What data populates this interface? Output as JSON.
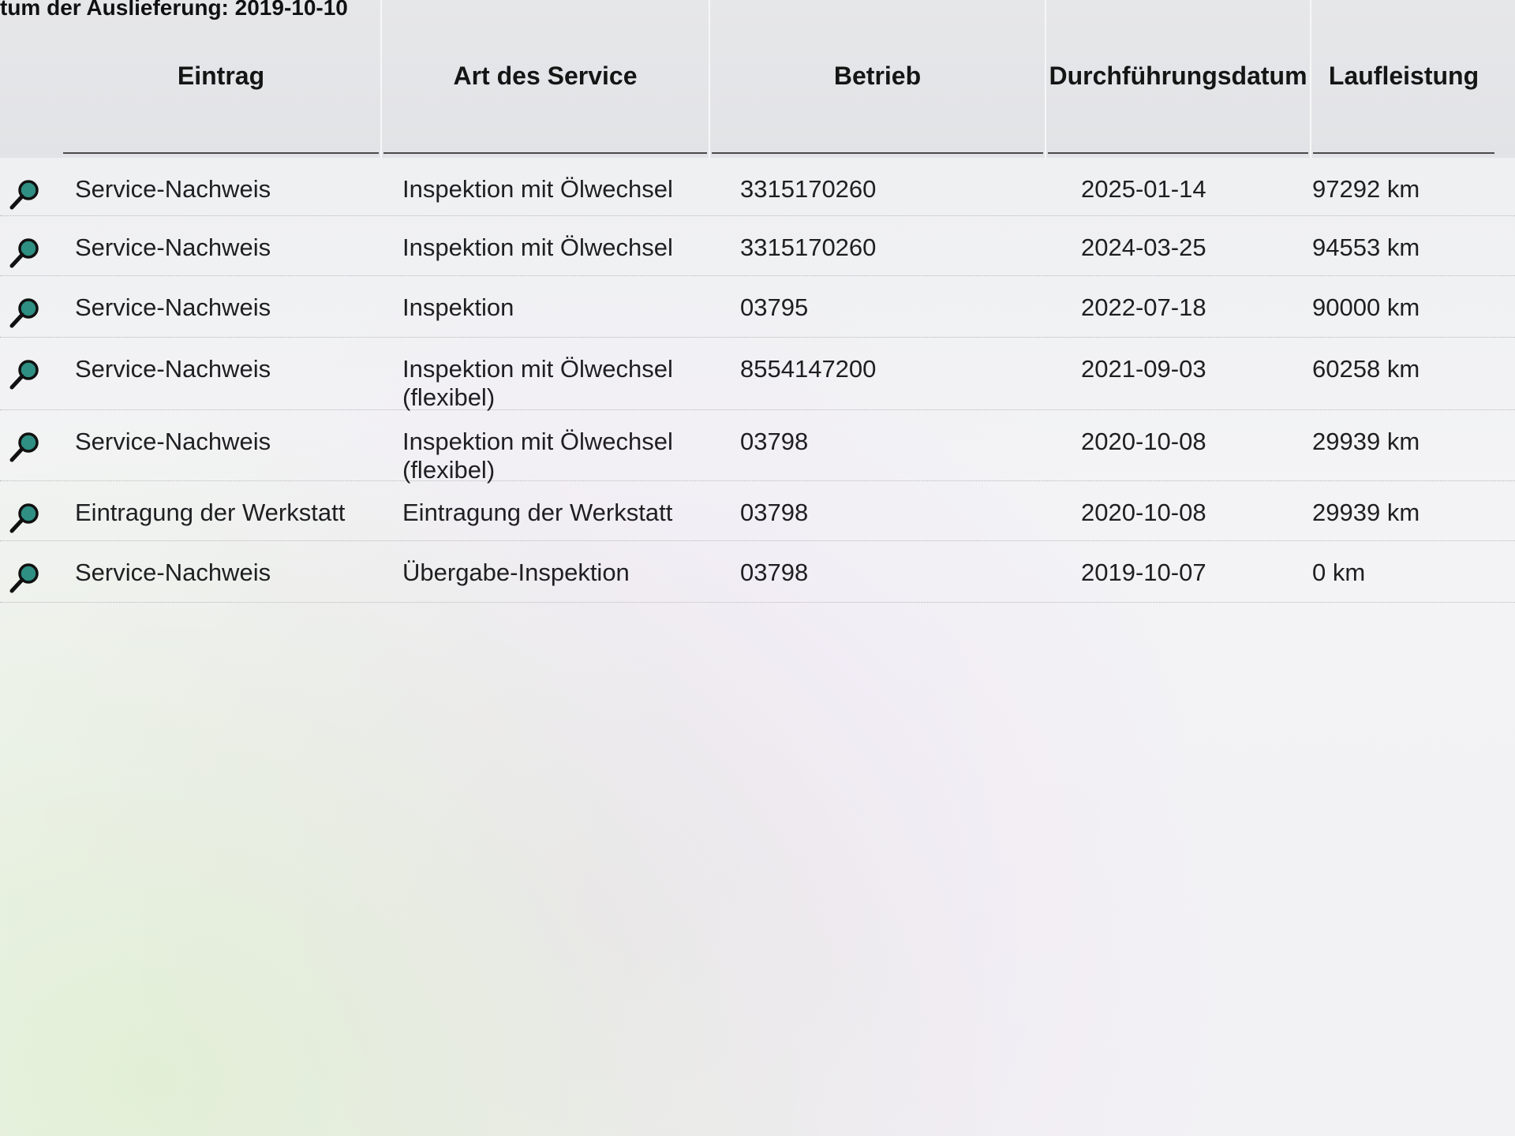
{
  "page": {
    "top_text": "tum der Auslieferung: 2019-10-10"
  },
  "table": {
    "headers": {
      "entry": "Eintrag",
      "service": "Art des Service",
      "betrieb": "Betrieb",
      "date": "Durchführungsdatum",
      "mileage": "Laufleistung"
    },
    "rows": [
      {
        "entry": "Service-Nachweis",
        "service_line1": "Inspektion mit Ölwechsel",
        "service_line2": "",
        "betrieb": "3315170260",
        "date": "2025-01-14",
        "mileage": "97292 km"
      },
      {
        "entry": "Service-Nachweis",
        "service_line1": "Inspektion mit Ölwechsel",
        "service_line2": "",
        "betrieb": "3315170260",
        "date": "2024-03-25",
        "mileage": "94553 km"
      },
      {
        "entry": "Service-Nachweis",
        "service_line1": "Inspektion",
        "service_line2": "",
        "betrieb": "03795",
        "date": "2022-07-18",
        "mileage": "90000 km"
      },
      {
        "entry": "Service-Nachweis",
        "service_line1": "Inspektion mit Ölwechsel",
        "service_line2": "(flexibel)",
        "betrieb": "8554147200",
        "date": "2021-09-03",
        "mileage": "60258 km"
      },
      {
        "entry": "Service-Nachweis",
        "service_line1": "Inspektion mit Ölwechsel",
        "service_line2": "(flexibel)",
        "betrieb": "03798",
        "date": "2020-10-08",
        "mileage": "29939 km"
      },
      {
        "entry": "Eintragung der Werkstatt",
        "service_line1": "Eintragung der Werkstatt",
        "service_line2": "",
        "betrieb": "03798",
        "date": "2020-10-08",
        "mileage": "29939 km"
      },
      {
        "entry": "Service-Nachweis",
        "service_line1": "Übergabe-Inspektion",
        "service_line2": "",
        "betrieb": "03798",
        "date": "2019-10-07",
        "mileage": "0 km"
      }
    ]
  },
  "icons": {
    "row_action": "magnifier-icon"
  },
  "colors": {
    "icon_lens": "#2e8f82",
    "icon_handle": "#1a1a1a"
  }
}
